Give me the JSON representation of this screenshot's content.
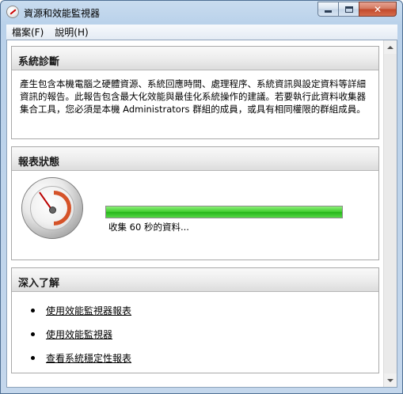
{
  "window": {
    "title": "資源和效能監視器",
    "buttons": {
      "minimize": "minimize-icon",
      "maximize": "maximize-icon",
      "close": "✕"
    }
  },
  "menu": [
    {
      "label": "檔案(F)"
    },
    {
      "label": "說明(H)"
    }
  ],
  "panels": {
    "diagnostics": {
      "title": "系統診斷",
      "description": "產生包含本機電腦之硬體資源、系統回應時間、處理程序、系統資訊與設定資料等詳細資訊的報告。此報告包含最大化效能與最佳化系統操作的建議。若要執行此資料收集器集合工具，您必須是本機 Administrators 群組的成員，或具有相同權限的群組成員。"
    },
    "status": {
      "title": "報表狀態",
      "progress_fraction": 1.0,
      "progress_text": "收集 60 秒的資料..."
    },
    "learn_more": {
      "title": "深入了解",
      "links": [
        {
          "label": "使用效能監視器報表"
        },
        {
          "label": "使用效能監視器"
        },
        {
          "label": "查看系統穩定性報表"
        }
      ]
    }
  },
  "colors": {
    "progress": "#3ccc2b",
    "close_button": "#c2482a"
  }
}
